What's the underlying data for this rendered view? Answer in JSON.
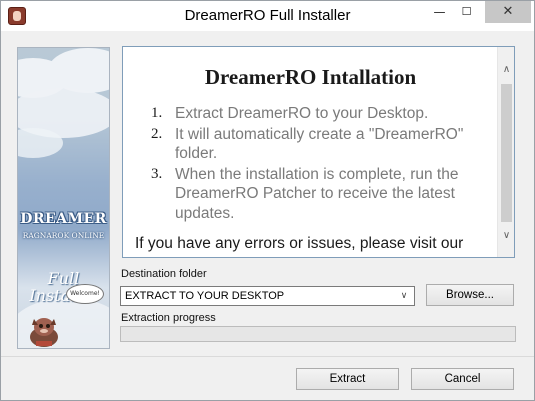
{
  "window": {
    "title": "DreamerRO Full Installer",
    "controls": {
      "minimize_glyph": "—",
      "maximize_glyph": "☐",
      "close_glyph": "✕"
    }
  },
  "banner": {
    "brand": "DREAMER",
    "subtitle": "RAGNAROK ONLINE",
    "line1": "Full",
    "line2": "Installer",
    "bubble": "Welcome!"
  },
  "content": {
    "heading": "DreamerRO Intallation",
    "steps": [
      {
        "num": "1.",
        "text": "Extract DreamerRO to your Desktop."
      },
      {
        "num": "2.",
        "text": "It will automatically create a \"DreamerRO\" folder."
      },
      {
        "num": "3.",
        "text": "When the installation is complete, run the DreamerRO Patcher to receive the latest updates."
      }
    ],
    "note": "If you have any errors or issues, please visit our"
  },
  "scrollbar": {
    "up_glyph": "∧",
    "down_glyph": "∨"
  },
  "destination": {
    "label": "Destination folder",
    "value": "EXTRACT TO YOUR DESKTOP",
    "dropdown_glyph": "∨",
    "browse_label": "Browse..."
  },
  "progress": {
    "label": "Extraction progress",
    "value": 0
  },
  "footer": {
    "extract_label": "Extract",
    "cancel_label": "Cancel"
  },
  "colors": {
    "progress_fill": "#06b025",
    "frame_border": "#7f9db9"
  }
}
